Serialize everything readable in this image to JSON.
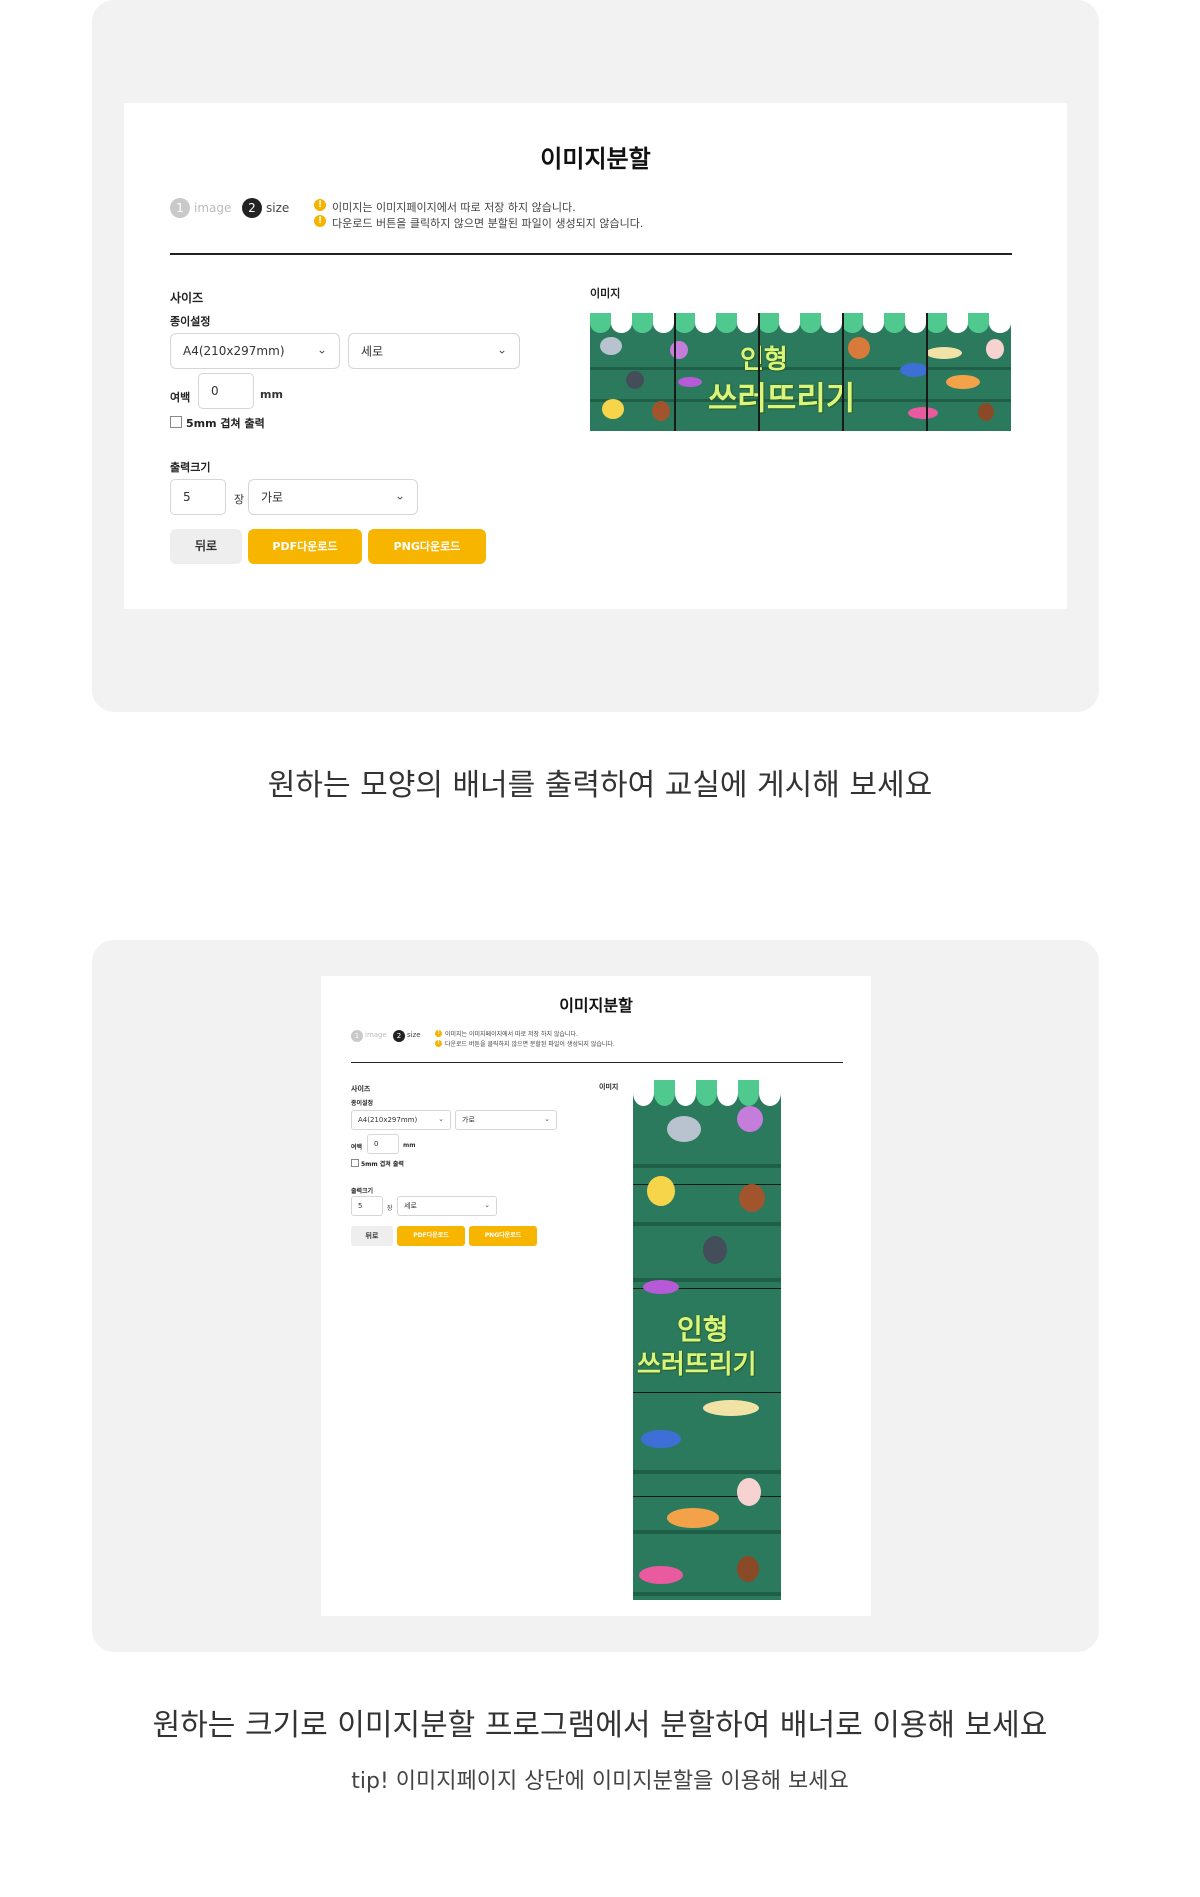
{
  "top_screenshot": {
    "title": "이미지분할",
    "steps": [
      {
        "num": "1",
        "label": "image"
      },
      {
        "num": "2",
        "label": "size"
      }
    ],
    "notices": [
      "이미지는 이미지페이지에서 따로 저장 하지 않습니다.",
      "다운로드 버튼을 클릭하지 않으면 분할된 파일이 생성되지 않습니다."
    ],
    "size_label": "사이즈",
    "paper_label": "종이설정",
    "paper_select": "A4(210x297mm)",
    "orientation_select": "세로",
    "margin_label": "여백",
    "margin_value": "0",
    "margin_unit": "mm",
    "overlap_label": "5mm 겹쳐 출력",
    "output_label": "출력크기",
    "count_value": "5",
    "count_unit": "장",
    "direction_select": "가로",
    "back_button": "뒤로",
    "pdf_button": "PDF다운로드",
    "png_button": "PNG다운로드",
    "image_label": "이미지",
    "banner_text_line1": "인형",
    "banner_text_line2": "쓰러뜨리기"
  },
  "caption1": "원하는 모양의 배너를 출력하여 교실에 게시해 보세요",
  "bottom_screenshot": {
    "title": "이미지분할",
    "steps": [
      {
        "num": "1",
        "label": "image"
      },
      {
        "num": "2",
        "label": "size"
      }
    ],
    "notices": [
      "이미지는 이미지페이지에서 따로 저장 하지 않습니다.",
      "다운로드 버튼을 클릭하지 않으면 분할된 파일이 생성되지 않습니다."
    ],
    "size_label": "사이즈",
    "paper_label": "종이설정",
    "paper_select": "A4(210x297mm)",
    "orientation_select": "가로",
    "margin_label": "여백",
    "margin_value": "0",
    "margin_unit": "mm",
    "overlap_label": "5mm 겹쳐 출력",
    "output_label": "출력크기",
    "count_value": "5",
    "count_unit": "장",
    "direction_select": "세로",
    "back_button": "뒤로",
    "pdf_button": "PDF다운로드",
    "png_button": "PNG다운로드",
    "image_label": "이미지",
    "banner_text_line1": "인형",
    "banner_text_line2": "쓰러뜨리기"
  },
  "caption2": "원하는 크기로 이미지분할 프로그램에서 분할하여 배너로 이용해 보세요",
  "caption3": "tip! 이미지페이지 상단에 이미지분할을 이용해 보세요",
  "colors": {
    "accent": "#f7b500",
    "banner_green": "#2c7a5d",
    "awning_green": "#4fc98e",
    "panel_bg": "#f2f2f2"
  }
}
